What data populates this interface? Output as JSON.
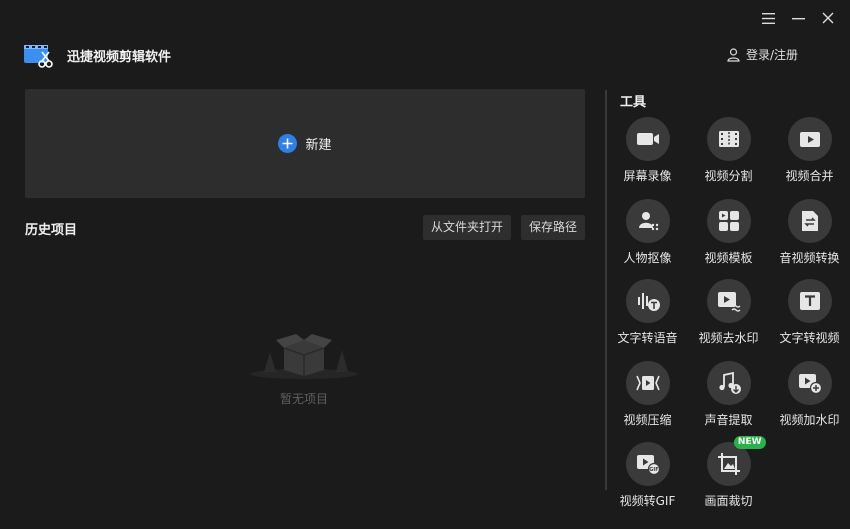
{
  "app": {
    "title": "迅捷视频剪辑软件"
  },
  "header": {
    "login_label": "登录/注册"
  },
  "new_project": {
    "label": "新建"
  },
  "history": {
    "title": "历史项目",
    "open_folder_label": "从文件夹打开",
    "save_path_label": "保存路径",
    "empty_label": "暂无项目"
  },
  "tools": {
    "title": "工具",
    "items": [
      {
        "label": "屏幕录像",
        "icon": "camera-icon"
      },
      {
        "label": "视频分割",
        "icon": "film-split-icon"
      },
      {
        "label": "视频合并",
        "icon": "video-play-icon"
      },
      {
        "label": "人物抠像",
        "icon": "person-matting-icon"
      },
      {
        "label": "视频模板",
        "icon": "template-icon"
      },
      {
        "label": "音视频转换",
        "icon": "convert-file-icon"
      },
      {
        "label": "文字转语音",
        "icon": "text-to-speech-icon"
      },
      {
        "label": "视频去水印",
        "icon": "remove-watermark-icon"
      },
      {
        "label": "文字转视频",
        "icon": "text-to-video-icon"
      },
      {
        "label": "视频压缩",
        "icon": "compress-icon"
      },
      {
        "label": "声音提取",
        "icon": "music-extract-icon"
      },
      {
        "label": "视频加水印",
        "icon": "add-watermark-icon"
      },
      {
        "label": "视频转GIF",
        "icon": "gif-icon"
      },
      {
        "label": "画面裁切",
        "icon": "crop-icon",
        "badge": "NEW"
      }
    ]
  },
  "colors": {
    "accent": "#2f7fe6",
    "badge": "#27b24a",
    "background": "#1b1b1b",
    "panel": "#2d2d2d"
  }
}
